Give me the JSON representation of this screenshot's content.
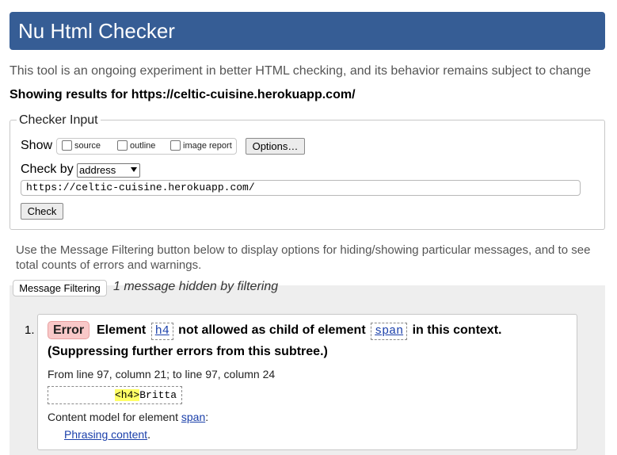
{
  "app_title": "Nu Html Checker",
  "intro_text": "This tool is an ongoing experiment in better HTML checking, and its behavior remains subject to change",
  "showing_results": "Showing results for https://celtic-cuisine.herokuapp.com/",
  "checker_input": {
    "legend": "Checker Input",
    "show_label": "Show",
    "show_options": [
      {
        "label": "source",
        "checked": false
      },
      {
        "label": "outline",
        "checked": false
      },
      {
        "label": "image report",
        "checked": false
      }
    ],
    "options_button": "Options…",
    "check_by_label": "Check by",
    "check_by_value": "address",
    "url_value": "https://celtic-cuisine.herokuapp.com/",
    "check_button": "Check"
  },
  "filter_info": "Use the Message Filtering button below to display options for hiding/showing particular messages, and to see total counts of errors and warnings.",
  "message_filtering_button": "Message Filtering",
  "hidden_note": "1 message hidden by filtering",
  "messages": [
    {
      "number": "1.",
      "type": "Error",
      "text_part1": "Element",
      "element": "h4",
      "text_part2": "not allowed as child of element",
      "parent_element": "span",
      "text_part3": "in this context.",
      "text_line2": "(Suppressing further errors from this subtree.)",
      "location": "From line 97, column 21; to line 97, column 24",
      "extract_tag": "<h4>",
      "extract_text": "Britta",
      "content_model_label": "Content model for element",
      "content_model_element": "span",
      "content_model_colon": ":",
      "content_model_link": "Phrasing content",
      "content_model_period": "."
    }
  ],
  "colors": {
    "banner": "#365d95",
    "error_badge": "#f8c8c8",
    "highlight": "#ffff66",
    "link": "#1a3faa",
    "results_background": "#eeeeee"
  }
}
